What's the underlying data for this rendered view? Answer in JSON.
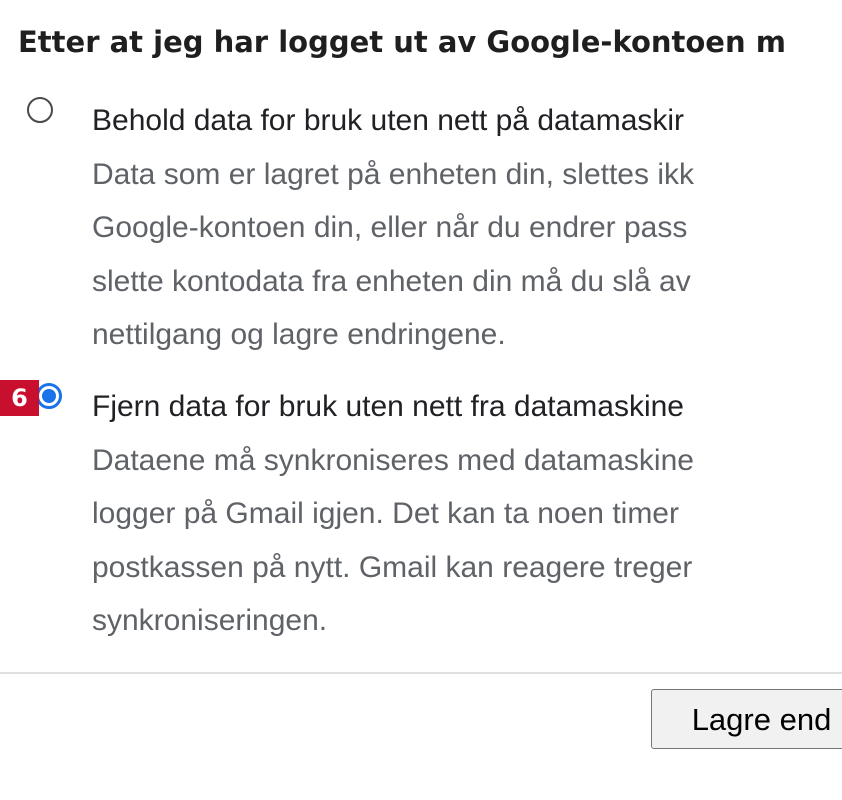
{
  "heading": "Etter at jeg har logget ut av Google-kontoen m",
  "options": [
    {
      "title": "Behold data for bruk uten nett på datamaskir",
      "description": [
        "Data som er lagret på enheten din, slettes ikk",
        "Google-kontoen din, eller når du endrer pass",
        "slette kontodata fra enheten din må du slå av",
        "nettilgang og lagre endringene."
      ],
      "selected": false
    },
    {
      "title": "Fjern data for bruk uten nett fra datamaskine",
      "description": [
        "Dataene må synkroniseres med datamaskine",
        "logger på Gmail igjen. Det kan ta noen timer",
        "postkassen på nytt. Gmail kan reagere treger",
        "synkroniseringen."
      ],
      "selected": true
    }
  ],
  "annotation_badge": "6",
  "save_button_label": "Lagre end",
  "colors": {
    "accent": "#1a73e8",
    "badge": "#c8102e"
  }
}
